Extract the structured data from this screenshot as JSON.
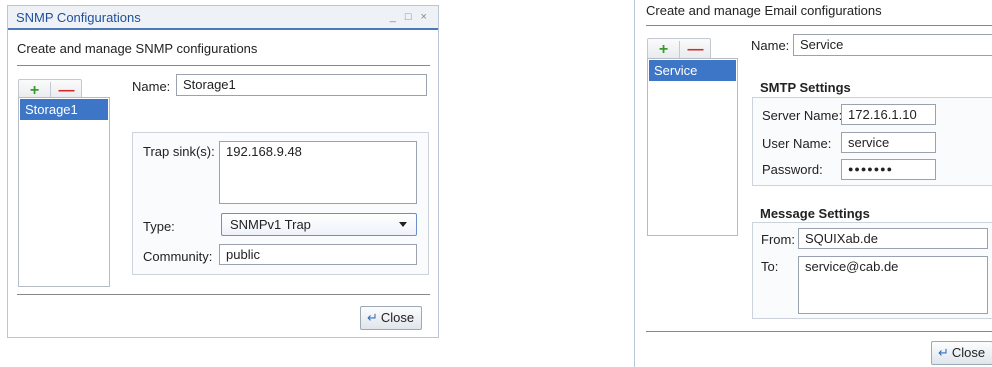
{
  "snmp": {
    "window_title": "SNMP Configurations",
    "window_controls": "_ □ ×",
    "heading": "Create and manage SNMP configurations",
    "toolbar": {
      "add_label": "+",
      "remove_label": "—"
    },
    "list": {
      "items": [
        "Storage1"
      ],
      "selected": "Storage1"
    },
    "name_label": "Name:",
    "name_value": "Storage1",
    "trap_sinks_label": "Trap sink(s):",
    "trap_sinks_value": "192.168.9.48",
    "type_label": "Type:",
    "type_value": "SNMPv1 Trap",
    "community_label": "Community:",
    "community_value": "public",
    "close_label": "Close"
  },
  "email": {
    "heading": "Create and manage Email configurations",
    "toolbar": {
      "add_label": "+",
      "remove_label": "—"
    },
    "list": {
      "items": [
        "Service"
      ],
      "selected": "Service"
    },
    "name_label": "Name:",
    "name_value": "Service",
    "smtp": {
      "heading": "SMTP Settings",
      "server_label": "Server Name:",
      "server_value": "172.16.1.10",
      "user_label": "User Name:",
      "user_value": "service",
      "password_label": "Password:",
      "password_mask": "●●●●●●●"
    },
    "message": {
      "heading": "Message Settings",
      "from_label": "From:",
      "from_value": "SQUIXab.de",
      "to_label": "To:",
      "to_value": "service@cab.de"
    },
    "close_label": "Close"
  },
  "colors": {
    "accent": "#4a78b8",
    "selection": "#3d76c7",
    "add_green": "#3a9a2c",
    "remove_red": "#d22a2a"
  }
}
